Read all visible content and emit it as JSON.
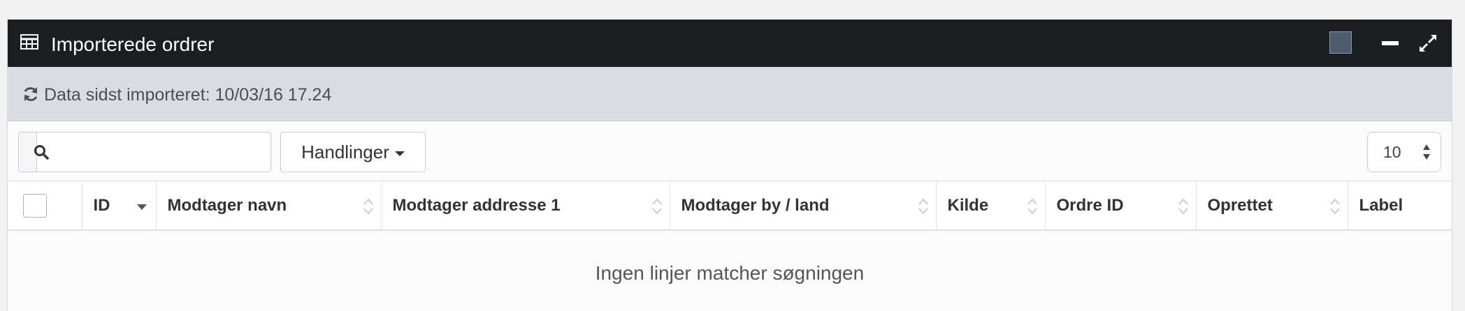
{
  "window": {
    "title": "Importerede ordrer",
    "icons": [
      "table-icon",
      "color-swatch-icon",
      "minimize-icon",
      "expand-icon"
    ]
  },
  "info": {
    "text": "Data sidst importeret: 10/03/16 17.24",
    "icon": "refresh-icon"
  },
  "toolbar": {
    "search": {
      "value": "",
      "placeholder": ""
    },
    "actions_label": "Handlinger",
    "page_size": "10"
  },
  "table": {
    "columns": [
      {
        "key": "id",
        "label": "ID",
        "sort": "desc"
      },
      {
        "key": "name",
        "label": "Modtager navn",
        "sort": "none"
      },
      {
        "key": "address",
        "label": "Modtager addresse 1",
        "sort": "none"
      },
      {
        "key": "city",
        "label": "Modtager by / land",
        "sort": "none"
      },
      {
        "key": "source",
        "label": "Kilde",
        "sort": "none"
      },
      {
        "key": "order_id",
        "label": "Ordre ID",
        "sort": "none"
      },
      {
        "key": "created",
        "label": "Oprettet",
        "sort": "none"
      },
      {
        "key": "label",
        "label": "Label",
        "sort": "none"
      }
    ],
    "empty_text": "Ingen linjer matcher søgningen"
  },
  "colors": {
    "titlebar_bg": "#1b1e22",
    "infobar_bg": "#d8dde4",
    "swatch": "#4e5d6e"
  }
}
